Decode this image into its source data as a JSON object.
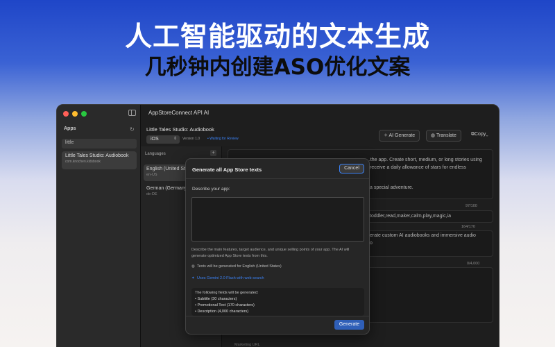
{
  "hero": {
    "headline": "人工智能驱动的文本生成",
    "subheadline": "几秒钟内创建ASO优化文案"
  },
  "window": {
    "title": "AppStoreConnect API AI",
    "traffic_colors": [
      "#ff5f57",
      "#febc2e",
      "#28c840"
    ]
  },
  "sidebar": {
    "header": "Apps",
    "search_value": "little",
    "apps": [
      {
        "name": "Little Tales Studio: Audiobook",
        "subtitle": "com.knochen.kidsbook"
      }
    ]
  },
  "toolbar": {
    "app_title": "Little Tales Studio: Audiobook",
    "platform": "iOS",
    "version": "Version 1.0",
    "status": "Waiting for Review",
    "ai_generate": "AI Generate",
    "translate": "Translate",
    "copy": "Copy"
  },
  "languages": {
    "header": "Languages",
    "add": "+",
    "items": [
      {
        "name": "English (United States)",
        "code": "en-US"
      },
      {
        "name": "German (Germany)",
        "code": "de-DE"
      }
    ]
  },
  "content": {
    "desc_line1": "...the app. Create short, medium, or long stories using",
    "desc_line2": "receive a daily allowance of stars for endless",
    "desc_line3": "a special adventure.",
    "kw_count": "97/100",
    "keywords": "toddler,read,maker,calm,play,magic,ia",
    "promo_count": "164/170",
    "promo_line1": "erate custom AI audiobooks and immersive audio",
    "promo_line2": "o",
    "whatsnew_count": "0/4,000",
    "marketing_label": "Marketing URL"
  },
  "modal": {
    "title": "Generate all App Store texts",
    "cancel": "Cancel",
    "describe_label": "Describe your app:",
    "hint": "Describe the main features, target audience, and unique selling points of your app. The AI will generate optimized App Store texts from this.",
    "language_note": "Texts will be generated for English (United States)",
    "model_note": "Uses Gemini 2.0 Flash with web search",
    "fields_header": "The following fields will be generated:",
    "fields": [
      "• Subtitle (30 characters)",
      "• Promotional Text (170 characters)",
      "• Description (4,000 characters)"
    ],
    "generate": "Generate"
  }
}
